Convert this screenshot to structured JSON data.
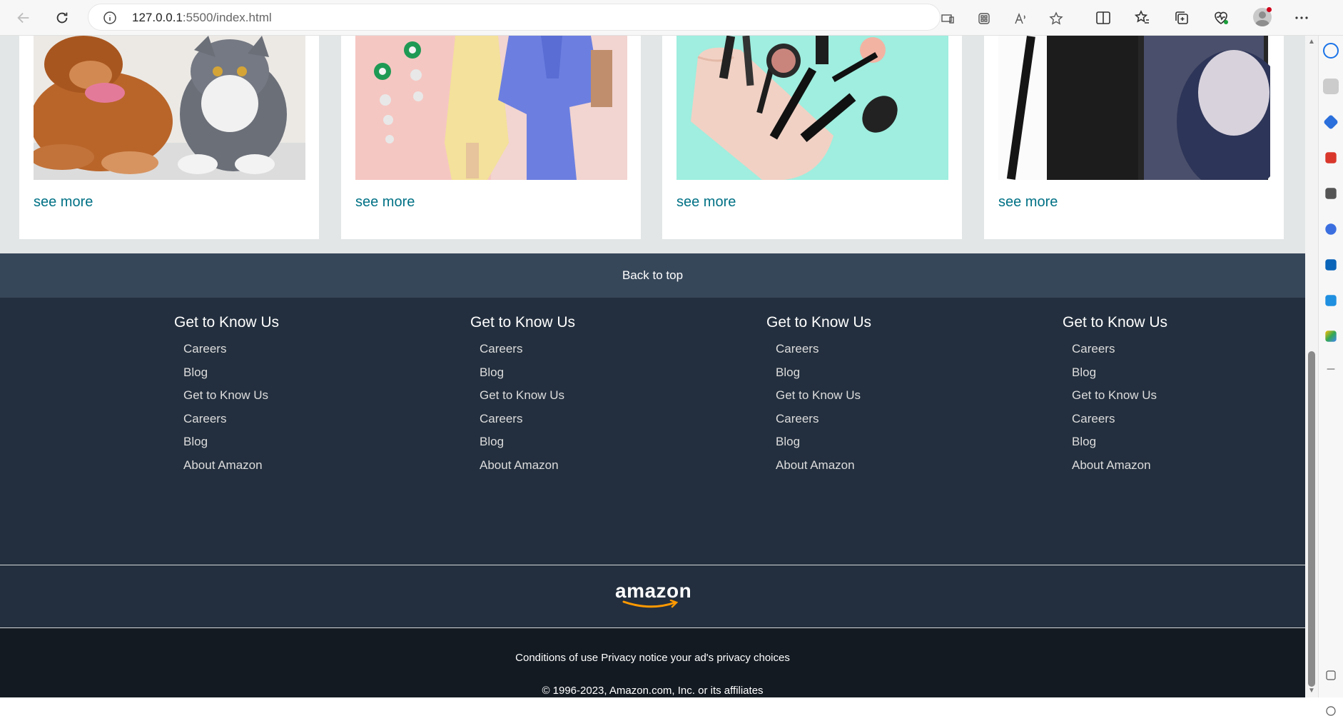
{
  "browser": {
    "url_host": "127.0.0.1",
    "url_path": ":5500/index.html"
  },
  "cards": [
    {
      "image": "pets-dog-and-cat",
      "link": "see more"
    },
    {
      "image": "fashion-outfits",
      "link": "see more"
    },
    {
      "image": "beauty-makeup",
      "link": "see more"
    },
    {
      "image": "samsung-phone",
      "link": "see more"
    }
  ],
  "back_to_top": "Back to top",
  "footer": {
    "columns": [
      {
        "heading": "Get to Know Us",
        "links": [
          "Careers",
          "Blog",
          "Get to Know Us",
          "Careers",
          "Blog",
          "About Amazon"
        ]
      },
      {
        "heading": "Get to Know Us",
        "links": [
          "Careers",
          "Blog",
          "Get to Know Us",
          "Careers",
          "Blog",
          "About Amazon"
        ]
      },
      {
        "heading": "Get to Know Us",
        "links": [
          "Careers",
          "Blog",
          "Get to Know Us",
          "Careers",
          "Blog",
          "About Amazon"
        ]
      },
      {
        "heading": "Get to Know Us",
        "links": [
          "Careers",
          "Blog",
          "Get to Know Us",
          "Careers",
          "Blog",
          "About Amazon"
        ]
      }
    ],
    "logo_text": "amazon",
    "legal_links": "Conditions of use Privacy notice your ad's privacy choices",
    "copyright": "© 1996-2023, Amazon.com, Inc. or its affiliates"
  },
  "colors": {
    "link": "#007185",
    "back_to_top_bg": "#37475a",
    "footer_bg": "#232f3e",
    "bottom_bg": "#131a22",
    "logo_smile": "#ff9900"
  }
}
